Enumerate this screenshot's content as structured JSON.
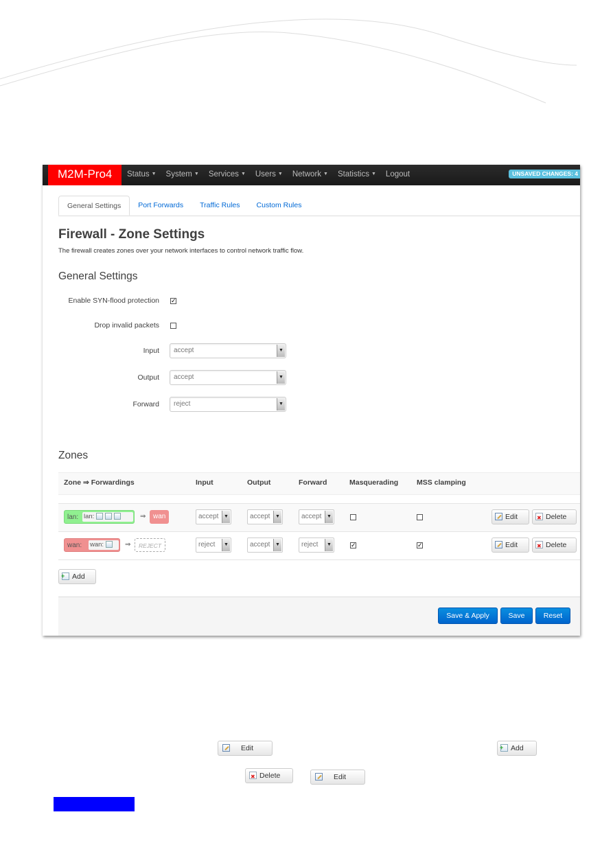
{
  "navbar": {
    "brand": "M2M-Pro4",
    "items": [
      {
        "label": "Status",
        "has_dropdown": true
      },
      {
        "label": "System",
        "has_dropdown": true
      },
      {
        "label": "Services",
        "has_dropdown": true
      },
      {
        "label": "Users",
        "has_dropdown": true
      },
      {
        "label": "Network",
        "has_dropdown": true
      },
      {
        "label": "Statistics",
        "has_dropdown": true
      },
      {
        "label": "Logout",
        "has_dropdown": false
      }
    ],
    "caret": "▼",
    "unsaved_badge": "UNSAVED CHANGES: 4"
  },
  "tabs": [
    {
      "label": "General Settings",
      "active": true
    },
    {
      "label": "Port Forwards",
      "active": false
    },
    {
      "label": "Traffic Rules",
      "active": false
    },
    {
      "label": "Custom Rules",
      "active": false
    }
  ],
  "page": {
    "title": "Firewall - Zone Settings",
    "description": "The firewall creates zones over your network interfaces to control network traffic flow."
  },
  "general_settings": {
    "heading": "General Settings",
    "syn_flood": {
      "label": "Enable SYN-flood protection",
      "checked": true
    },
    "drop_invalid": {
      "label": "Drop invalid packets",
      "checked": false
    },
    "input": {
      "label": "Input",
      "value": "accept"
    },
    "output": {
      "label": "Output",
      "value": "accept"
    },
    "forward": {
      "label": "Forward",
      "value": "reject"
    }
  },
  "zones": {
    "heading": "Zones",
    "columns": [
      "Zone ⇒ Forwardings",
      "Input",
      "Output",
      "Forward",
      "Masquerading",
      "MSS clamping"
    ],
    "arrow": "⇒",
    "rows": [
      {
        "zone": "lan:",
        "iface_label": "lan:",
        "dest": "wan",
        "input": "accept",
        "output": "accept",
        "forward": "accept",
        "masquerading": false,
        "mss_clamping": false,
        "edit_label": "Edit",
        "delete_label": "Delete",
        "color": "#90f090"
      },
      {
        "zone": "wan:",
        "iface_label": "wan:",
        "dest": "REJECT",
        "input": "reject",
        "output": "accept",
        "forward": "reject",
        "masquerading": true,
        "mss_clamping": true,
        "edit_label": "Edit",
        "delete_label": "Delete",
        "color": "#f09090"
      }
    ],
    "add_label": "Add"
  },
  "footer": {
    "save_apply": "Save & Apply",
    "save": "Save",
    "reset": "Reset"
  },
  "below": {
    "edit1": "Edit",
    "add": "Add",
    "delete": "Delete",
    "edit2": "Edit"
  },
  "colors": {
    "brand": "#ff0000",
    "primary": "#0069d6",
    "badge": "#5bc0de",
    "lan_zone": "#90f090",
    "wan_zone": "#f09090",
    "marker": "#0000ff"
  }
}
